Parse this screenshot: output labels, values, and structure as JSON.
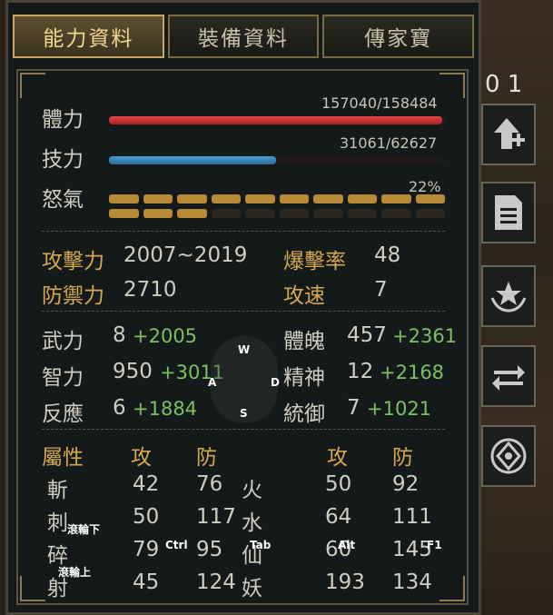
{
  "tabs": [
    "能力資料",
    "裝備資料",
    "傳家寶"
  ],
  "hp": {
    "label": "體力",
    "text": "157040/158484",
    "fraction": 0.991
  },
  "sp": {
    "label": "技力",
    "text": "31061/62627",
    "fraction": 0.496
  },
  "rage": {
    "label": "怒氣",
    "text": "22%",
    "filled": 13,
    "total": 20
  },
  "combat": {
    "atk_label": "攻擊力",
    "atk": "2007~2019",
    "def_label": "防禦力",
    "def": "2710",
    "crit_label": "爆擊率",
    "crit": "48",
    "spd_label": "攻速",
    "spd": "7"
  },
  "attrs": [
    {
      "label": "武力",
      "base": "8",
      "bonus": "+2005"
    },
    {
      "label": "智力",
      "base": "950",
      "bonus": "+3011"
    },
    {
      "label": "反應",
      "base": "6",
      "bonus": "+1884"
    },
    {
      "label": "體魄",
      "base": "457",
      "bonus": "+2361"
    },
    {
      "label": "精神",
      "base": "12",
      "bonus": "+2168"
    },
    {
      "label": "統御",
      "base": "7",
      "bonus": "+1021"
    }
  ],
  "elem_header": {
    "title": "屬性",
    "atk": "攻",
    "def": "防"
  },
  "elements": [
    {
      "name": "斬",
      "atk": "42",
      "def": "76"
    },
    {
      "name": "刺",
      "atk": "50",
      "def": "117"
    },
    {
      "name": "碎",
      "atk": "79",
      "def": "95"
    },
    {
      "name": "射",
      "atk": "45",
      "def": "124"
    },
    {
      "name": "火",
      "atk": "50",
      "def": "92"
    },
    {
      "name": "水",
      "atk": "64",
      "def": "111"
    },
    {
      "name": "仙",
      "atk": "60",
      "def": "145"
    },
    {
      "name": "妖",
      "atk": "193",
      "def": "134"
    }
  ],
  "overlay_keys": {
    "w": "W",
    "a": "A",
    "s": "S",
    "d": "D",
    "scroll_down": "滾輪下",
    "scroll_up": "滾輪上",
    "ctrl": "Ctrl",
    "tab": "Tab",
    "alt": "Alt",
    "f1": "F1"
  },
  "top_right_num": "0 1",
  "side_icons": [
    "level-up-icon",
    "document-icon",
    "emblem-icon",
    "swap-icon",
    "crest-icon"
  ]
}
